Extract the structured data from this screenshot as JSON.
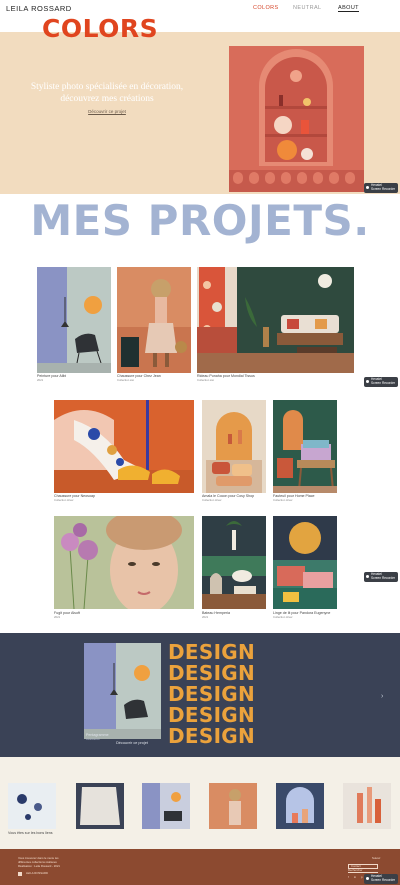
{
  "header": {
    "brand": "LEILA ROSSARD",
    "nav": [
      {
        "label": "COLORS",
        "active": true
      },
      {
        "label": "NEUTRAL",
        "active": false
      },
      {
        "label": "ABOUT",
        "active": false
      }
    ]
  },
  "hero": {
    "logo": "COLORS",
    "tagline": "Styliste photo spécialisée en décoration, découvrez mes créations",
    "discover": "Découvrir ce projet"
  },
  "recorder": {
    "line1": "Hexatel",
    "line2": "Screen Recorder"
  },
  "projects": {
    "title": "MES PROJETS.",
    "row1": [
      {
        "caption": "Peinture pour Alibi",
        "sub": "2021"
      },
      {
        "caption": "Chaussure pour Chez Jean",
        "sub": "Collection été"
      },
      {
        "caption": "Rideau Punaha pour Mondial Tissus",
        "sub": "Collection été"
      }
    ],
    "row2": [
      {
        "caption": "Chaussure pour Neosoap",
        "sub": "Collection Hiver"
      },
      {
        "caption": "Amala le Cocon pour Cosy Shop",
        "sub": "Collection Hiver"
      },
      {
        "caption": "Fauteuil pour Home Place",
        "sub": "Collection Hiver"
      }
    ],
    "row3": [
      {
        "caption": "Fugit pour Alsoft",
        "sub": "2021"
      },
      {
        "caption": "Bateau Hemperia",
        "sub": "2021"
      },
      {
        "caption": "Linge de lit pour Pandora Eugenyne",
        "sub": "Collection Hiver"
      }
    ]
  },
  "design": {
    "words": [
      "DESIGN",
      "DESIGN",
      "DESIGN",
      "DESIGN",
      "DESIGN"
    ],
    "caption": "Pentagramme",
    "sub": "Réalisation",
    "link": "Découvrir ce projet",
    "arrow": "›"
  },
  "strip": {
    "caption": "Vous êtes sur les bons liens"
  },
  "footer": {
    "lines": [
      "Vous trouverez dans le menu les",
      "différentes collections réalisées",
      "Réalisation : Leila Rossard - 2021"
    ],
    "brand": "LEILA ROSSARD",
    "contact": "Contact",
    "search": "Rechercher",
    "follow": "Suivez",
    "socials": [
      "f",
      "in",
      "p",
      "t"
    ]
  },
  "colors": {
    "accent": "#e0451f",
    "nav_active": "#d6472b",
    "hero_bg": "#f2dcbf",
    "title": "#a3b3d2",
    "design_bg": "#3a4256",
    "design_text": "#eba23c",
    "footer_bg": "#8c4a30"
  }
}
